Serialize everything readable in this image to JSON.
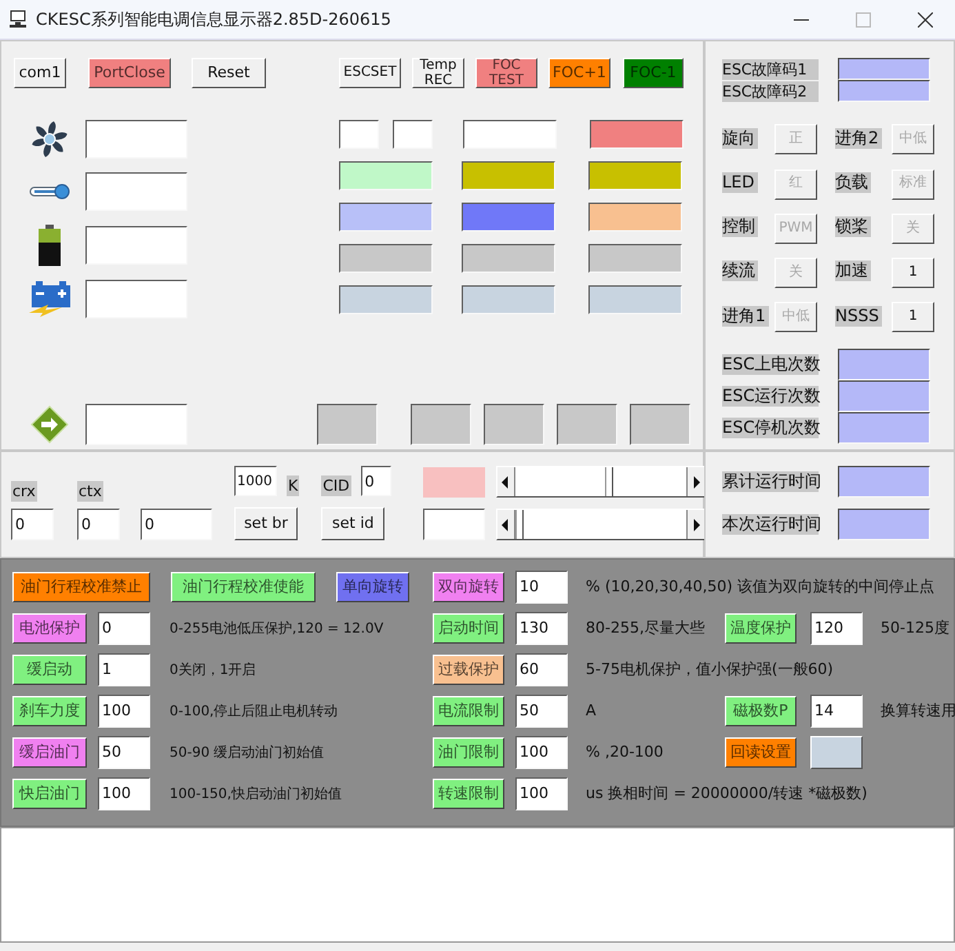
{
  "window": {
    "title": "CKESC系列智能电调信息显示器2.85D-260615"
  },
  "toolbar": [
    {
      "label": "com1"
    },
    {
      "label": "PortClose",
      "color": "#f08080"
    },
    {
      "label": "Reset"
    },
    {
      "label": "ESCSET"
    },
    {
      "label": "Temp REC"
    },
    {
      "label": "FOC TEST",
      "color": "#f08080"
    },
    {
      "label": "FOC+1",
      "color": "#ff8000"
    },
    {
      "label": "FOC-1",
      "color": "#008000"
    }
  ],
  "sensors": [
    {
      "kind": "fan"
    },
    {
      "kind": "thermometer"
    },
    {
      "kind": "battery"
    },
    {
      "kind": "charge"
    }
  ],
  "color_grid": [
    [
      {
        "kind": "half",
        "color": "#ffffff"
      },
      {
        "kind": "half",
        "color": "#ffffff"
      },
      {
        "kind": "full",
        "color": "#ffffff"
      },
      {
        "kind": "full",
        "color": "#f08080"
      }
    ],
    [
      {
        "kind": "full",
        "color": "#c0f8c8"
      },
      {
        "kind": "full",
        "color": "#c8c000"
      },
      {
        "kind": "full",
        "color": "#c8c000"
      }
    ],
    [
      {
        "kind": "full",
        "color": "#b8c0f8"
      },
      {
        "kind": "full",
        "color": "#7078f8"
      },
      {
        "kind": "full",
        "color": "#f8c090"
      }
    ],
    [
      {
        "kind": "full",
        "color": "#c8c8c8"
      },
      {
        "kind": "full",
        "color": "#c8c8c8"
      },
      {
        "kind": "full",
        "color": "#c8c8c8"
      }
    ],
    [
      {
        "kind": "full",
        "color": "#c8d4e0"
      },
      {
        "kind": "full",
        "color": "#c8d4e0"
      },
      {
        "kind": "full",
        "color": "#c8d4e0"
      }
    ]
  ],
  "status_row": {
    "kind": "arrow",
    "boxes": [
      {
        "color": "#c8c8c8"
      },
      {
        "color": "#c8c8c8"
      },
      {
        "color": "#c8c8c8"
      },
      {
        "color": "#c8c8c8"
      },
      {
        "color": "#c8c8c8"
      }
    ]
  },
  "link": {
    "crx_label": "crx",
    "crx": "0",
    "ctx_label": "ctx",
    "ctx": "0",
    "value_3": "0",
    "baud": "1000",
    "baud_unit": "K",
    "cid_label": "CID",
    "cid": "0",
    "set_br": "set br",
    "set_id": "set id",
    "indicator": {
      "color": "#f8c0c0"
    },
    "sliders": [
      {
        "level": 0.53
      },
      {
        "level": 0
      }
    ]
  },
  "fault_codes": [
    {
      "label": "ESC故障码1"
    },
    {
      "label": "ESC故障码2"
    }
  ],
  "settings": [
    {
      "label": "旋向",
      "value": "正",
      "disabled": true
    },
    {
      "label": "进角2",
      "value": "中低",
      "disabled": true
    },
    {
      "label": "LED",
      "value": "红",
      "disabled": true
    },
    {
      "label": "负载",
      "value": "标准",
      "disabled": true
    },
    {
      "label": "控制",
      "value": "PWM",
      "disabled": true
    },
    {
      "label": "锁桨",
      "value": "关",
      "disabled": true
    },
    {
      "label": "续流",
      "value": "关",
      "disabled": true
    },
    {
      "label": "加速",
      "value": "1",
      "disabled": false
    },
    {
      "label": "进角1",
      "value": "中低",
      "disabled": true
    },
    {
      "label": "NSSS",
      "value": "1",
      "disabled": false
    }
  ],
  "counters": [
    {
      "label": "ESC上电次数"
    },
    {
      "label": "ESC运行次数"
    },
    {
      "label": "ESC停机次数"
    }
  ],
  "runtime": [
    {
      "label": "累计运行时间"
    },
    {
      "label": "本次运行时间"
    }
  ],
  "parameter_rows": [
    {
      "buttons": [
        {
          "label": "油门行程校准禁止",
          "color": "#ff8000"
        },
        {
          "label": "油门行程校准使能",
          "color": "#80f080"
        },
        {
          "label": "单向旋转",
          "color": "#7070f0"
        }
      ],
      "middle": {
        "label": "双向旋转",
        "color": "#f080f0",
        "value": "10",
        "hint": "% (10,20,30,40,50) 该值为双向旋转的中间停止点"
      }
    },
    {
      "left": {
        "label": "电池保护",
        "color": "#f080f0",
        "value": "0",
        "hint": "0-255电池低压保护,120 = 12.0V"
      },
      "middle": {
        "label": "启动时间",
        "color": "#80f080",
        "value": "130",
        "hint": "80-255,尽量大些"
      },
      "right": {
        "kind": "input",
        "label": "温度保护",
        "color": "#80f080",
        "value": "120",
        "hint": "50-125度"
      }
    },
    {
      "left": {
        "label": "缓启动",
        "color": "#80f080",
        "value": "1",
        "hint": "0关闭，1开启"
      },
      "middle": {
        "label": "过载保护",
        "color": "#f8c090",
        "value": "60",
        "hint": "5-75电机保护，值小保护强(一般60)"
      }
    },
    {
      "left": {
        "label": "刹车力度",
        "color": "#80f080",
        "value": "100",
        "hint": "0-100,停止后阻止电机转动"
      },
      "middle": {
        "label": "电流限制",
        "color": "#80f080",
        "value": "50",
        "hint": "A"
      },
      "right": {
        "kind": "input",
        "label": "磁极数P",
        "color": "#80f080",
        "value": "14",
        "hint": "换算转速用"
      }
    },
    {
      "left": {
        "label": "缓启油门",
        "color": "#f080f0",
        "value": "50",
        "hint": "50-90 缓启动油门初始值"
      },
      "middle": {
        "label": "油门限制",
        "color": "#80f080",
        "value": "100",
        "hint": "% ,20-100"
      },
      "right": {
        "kind": "readback",
        "label": "回读设置",
        "color": "#ff8000"
      }
    },
    {
      "left": {
        "label": "快启油门",
        "color": "#80f080",
        "value": "100",
        "hint": "100-150,快启动油门初始值"
      },
      "middle": {
        "label": "转速限制",
        "color": "#80f080",
        "value": "100",
        "hint": "us 换相时间 = 20000000/转速 *磁极数)"
      }
    }
  ]
}
